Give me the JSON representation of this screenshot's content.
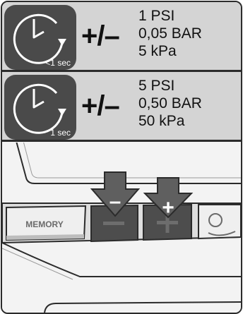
{
  "rows": [
    {
      "duration": "<1 sec",
      "symbol": "+/–",
      "values": [
        "1 PSI",
        "0,05 BAR",
        "5 kPa"
      ]
    },
    {
      "duration": "1 sec",
      "symbol": "+/–",
      "values": [
        "5 PSI",
        "0,50 BAR",
        "50 kPa"
      ]
    }
  ],
  "panel": {
    "memory_label": "MEMORY",
    "minus_label": "–",
    "plus_label": "+"
  },
  "colors": {
    "header_bg": "#d4d4d4",
    "clock_bg": "#4a4a4a",
    "button_dark": "#4d4d4d",
    "arrow": "#5f5f5f"
  }
}
